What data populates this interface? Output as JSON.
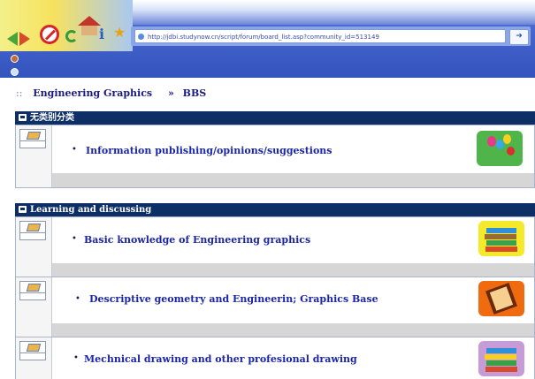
{
  "browser": {
    "address_url": "http://jdbi.studynow.cn/script/forum/board_list.asp?community_id=513149",
    "go_label": "➜"
  },
  "breadcrumb": {
    "separator": "::",
    "items": [
      "Engineering Graphics",
      "BBS"
    ],
    "arrow": "»"
  },
  "sections": [
    {
      "heading": "无类别分类",
      "boards": [
        {
          "title": "Information publishing/opinions/suggestions",
          "thumb_color": "#4fb54a",
          "thumb_icon": "balloons-icon"
        }
      ]
    },
    {
      "heading": "Learning and discussing",
      "boards": [
        {
          "title": "Basic knowledge of Engineering graphics",
          "thumb_color": "#f5ea2a",
          "thumb_icon": "book-stack-icon"
        },
        {
          "title": "Descriptive geometry and Engineerin; Graphics Base",
          "thumb_color": "#f06a10",
          "thumb_icon": "open-book-icon"
        },
        {
          "title": "Mechnical drawing and other profesional drawing",
          "thumb_color": "#c79ad8",
          "thumb_icon": "book-stack-icon"
        }
      ]
    }
  ],
  "bullet": "•"
}
